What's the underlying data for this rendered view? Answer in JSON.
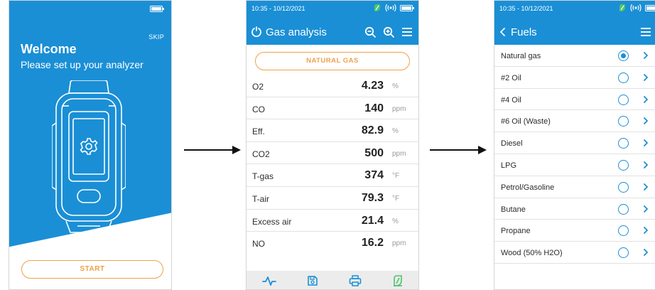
{
  "welcome_screen": {
    "skip_label": "SKIP",
    "title": "Welcome",
    "subtitle": "Please set up your analyzer",
    "start_label": "START"
  },
  "gas_screen": {
    "status_time": "10:35 - 10/12/2021",
    "title": "Gas analysis",
    "fuel_label": "NATURAL GAS",
    "measurements": [
      {
        "name": "O2",
        "value": "4.23",
        "unit": "%"
      },
      {
        "name": "CO",
        "value": "140",
        "unit": "ppm"
      },
      {
        "name": "Eff.",
        "value": "82.9",
        "unit": "%"
      },
      {
        "name": "CO2",
        "value": "500",
        "unit": "ppm"
      },
      {
        "name": "T-gas",
        "value": "374",
        "unit": "°F"
      },
      {
        "name": "T-air",
        "value": "79.3",
        "unit": "°F"
      },
      {
        "name": "Excess air",
        "value": "21.4",
        "unit": "%"
      },
      {
        "name": "NO",
        "value": "16.2",
        "unit": "ppm"
      }
    ],
    "bottom_icons": [
      "pulse-icon",
      "save-icon",
      "print-icon",
      "link-icon"
    ]
  },
  "fuels_screen": {
    "status_time": "10:35 - 10/12/2021",
    "title": "Fuels",
    "fuels": [
      {
        "name": "Natural gas",
        "selected": true
      },
      {
        "name": "#2 Oil",
        "selected": false
      },
      {
        "name": "#4 Oil",
        "selected": false
      },
      {
        "name": "#6 Oil (Waste)",
        "selected": false
      },
      {
        "name": "Diesel",
        "selected": false
      },
      {
        "name": "LPG",
        "selected": false
      },
      {
        "name": "Petrol/Gasoline",
        "selected": false
      },
      {
        "name": "Butane",
        "selected": false
      },
      {
        "name": "Propane",
        "selected": false
      },
      {
        "name": "Wood (50% H2O)",
        "selected": false
      }
    ]
  },
  "colors": {
    "brand_blue": "#1a8fd6",
    "accent_orange": "#f0a04b",
    "status_green": "#4cc46a"
  }
}
